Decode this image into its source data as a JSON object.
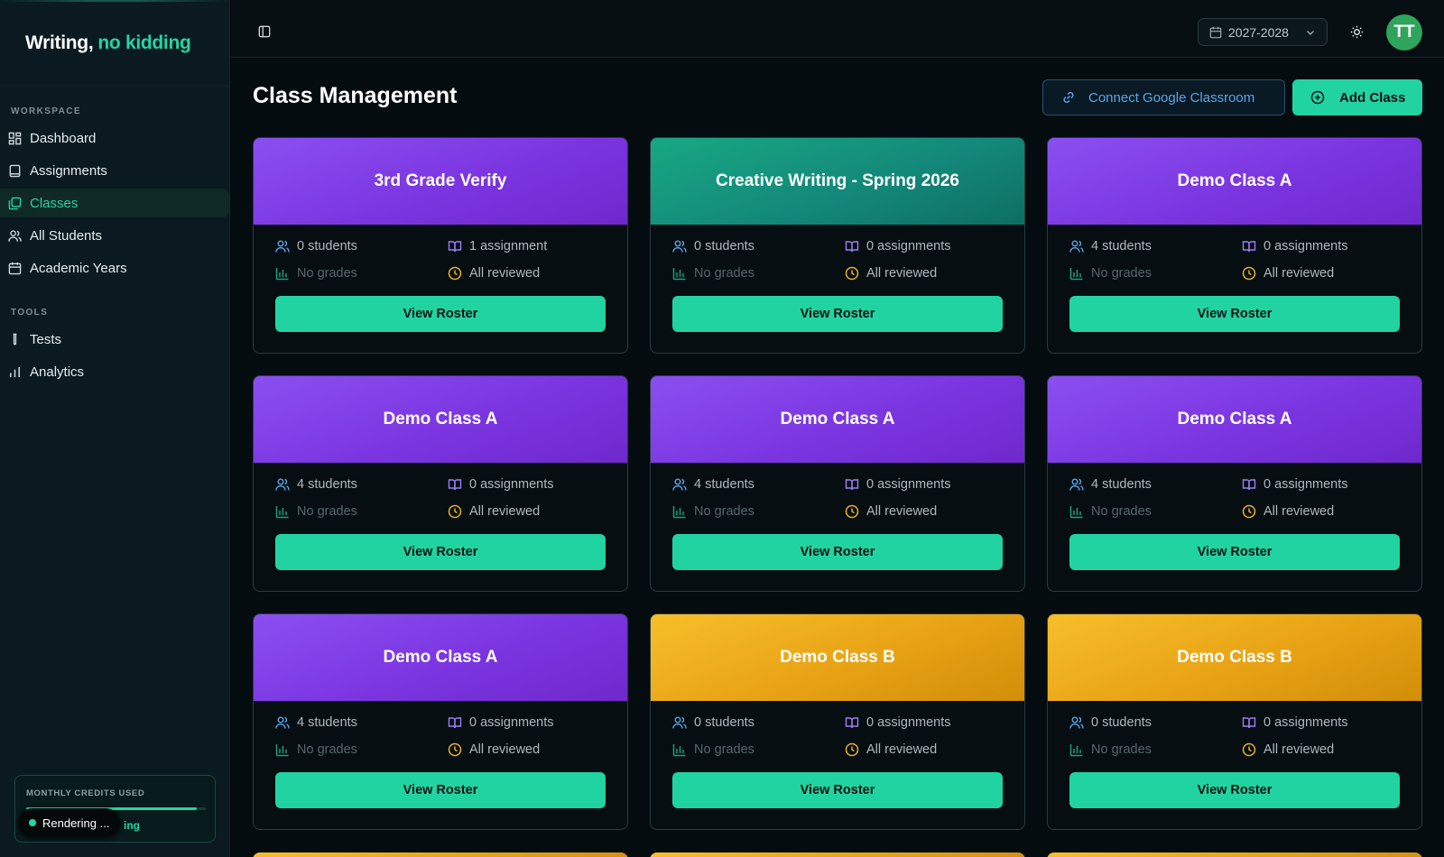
{
  "brand": {
    "part1": "Writing,",
    "part2": "no kidding"
  },
  "sidebar": {
    "workspace_title": "WORKSPACE",
    "workspace_items": [
      {
        "label": "Dashboard",
        "icon": "dashboard-icon",
        "active": false
      },
      {
        "label": "Assignments",
        "icon": "book-icon",
        "active": false
      },
      {
        "label": "Classes",
        "icon": "classes-icon",
        "active": true
      },
      {
        "label": "All Students",
        "icon": "users-icon",
        "active": false
      },
      {
        "label": "Academic Years",
        "icon": "calendar-icon",
        "active": false
      }
    ],
    "tools_title": "TOOLS",
    "tools_items": [
      {
        "label": "Tests",
        "icon": "test-tube-icon"
      },
      {
        "label": "Analytics",
        "icon": "bar-chart-icon"
      }
    ],
    "credits": {
      "title": "MONTHLY CREDITS USED",
      "progress": 0.95,
      "sub_label": "ing"
    }
  },
  "toast": {
    "label": "Rendering ..."
  },
  "topbar": {
    "academic_year": "2027-2028",
    "avatar_initials": "TT"
  },
  "main": {
    "title": "Class Management",
    "connect_button": "Connect Google Classroom",
    "add_button": "Add Class",
    "roster_button": "View Roster",
    "grades_text": "No grades",
    "reviewed_text": "All reviewed",
    "classes": [
      {
        "name": "3rd Grade Verify",
        "color": "purple",
        "students": "0 students",
        "assignments": "1 assignment"
      },
      {
        "name": "Creative Writing - Spring 2026",
        "color": "teal",
        "students": "0 students",
        "assignments": "0 assignments"
      },
      {
        "name": "Demo Class A",
        "color": "purple",
        "students": "4 students",
        "assignments": "0 assignments"
      },
      {
        "name": "Demo Class A",
        "color": "purple",
        "students": "4 students",
        "assignments": "0 assignments"
      },
      {
        "name": "Demo Class A",
        "color": "purple",
        "students": "4 students",
        "assignments": "0 assignments"
      },
      {
        "name": "Demo Class A",
        "color": "purple",
        "students": "4 students",
        "assignments": "0 assignments"
      },
      {
        "name": "Demo Class A",
        "color": "purple",
        "students": "4 students",
        "assignments": "0 assignments"
      },
      {
        "name": "Demo Class B",
        "color": "gold",
        "students": "0 students",
        "assignments": "0 assignments"
      },
      {
        "name": "Demo Class B",
        "color": "gold",
        "students": "0 students",
        "assignments": "0 assignments"
      }
    ]
  },
  "colors": {
    "accent": "#22d3a2",
    "purple": "#7b35e0",
    "teal": "#13897a",
    "gold": "#e8a315",
    "avatar": "#2fa45b"
  }
}
